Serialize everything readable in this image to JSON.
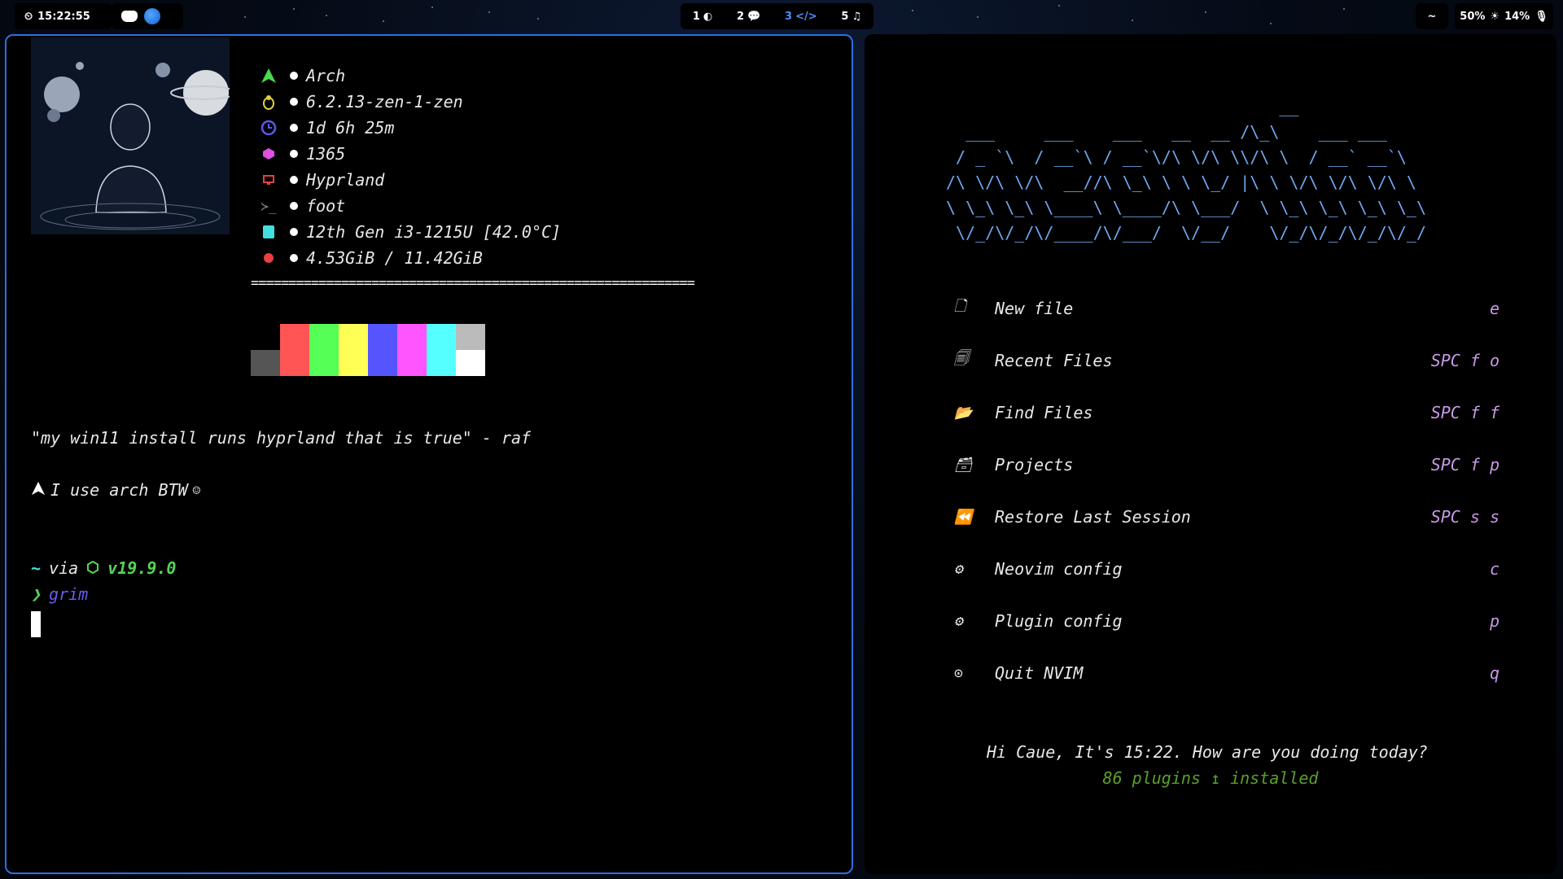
{
  "topbar": {
    "clock": "15:22:55",
    "apps": [
      "discord-icon",
      "browser-icon"
    ],
    "workspaces": [
      {
        "num": "1",
        "icon": "moon-icon",
        "active": false
      },
      {
        "num": "2",
        "icon": "chat-icon",
        "active": false
      },
      {
        "num": "3",
        "icon": "code-icon",
        "glyph": "</>",
        "active": true
      },
      {
        "num": "5",
        "icon": "music-icon",
        "active": false
      }
    ],
    "home": "~",
    "volume": "50%",
    "brightness": "14%"
  },
  "terminal": {
    "fetch": [
      {
        "icon": "arch-icon",
        "color": "#4ad94a",
        "text": "Arch"
      },
      {
        "icon": "linux-icon",
        "color": "#e0d040",
        "text": "6.2.13-zen-1-zen"
      },
      {
        "icon": "clock-icon",
        "color": "#5a5ae8",
        "text": "1d 6h 25m"
      },
      {
        "icon": "package-icon",
        "color": "#e050e0",
        "text": "1365"
      },
      {
        "icon": "monitor-icon",
        "color": "#e84040",
        "text": "Hyprland"
      },
      {
        "icon": "terminal-icon",
        "color": "#888888",
        "text": "foot"
      },
      {
        "icon": "cpu-icon",
        "color": "#40e0e0",
        "text": "12th Gen i3-1215U [42.0°C]"
      },
      {
        "icon": "memory-icon",
        "color": "#e84040",
        "text": "4.53GiB / 11.42GiB"
      }
    ],
    "separator": "===========================================================",
    "palette_top": [
      "#000000",
      "#ff5555",
      "#55ff55",
      "#ffff55",
      "#5555ff",
      "#ff55ff",
      "#55ffff",
      "#bbbbbb"
    ],
    "palette_bottom": [
      "#555555",
      "#ff5555",
      "#55ff55",
      "#ffff55",
      "#5555ff",
      "#ff55ff",
      "#55ffff",
      "#ffffff"
    ],
    "quote": "\"my win11 install runs hyprland that is true\" - raf",
    "btw": "I use arch BTW",
    "prompt_dir": "~",
    "prompt_via": "via",
    "node_version": "v19.9.0",
    "prompt_symbol": "❯",
    "command": "grim"
  },
  "nvim": {
    "logo": "                                  __\n  ___     ___    ___   __  __ /\\_\\    ___ ___\n / _ `\\  / __`\\ / __`\\/\\ \\/\\ \\\\/\\ \\  / __` __`\\\n/\\ \\/\\ \\/\\  __//\\ \\_\\ \\ \\ \\_/ |\\ \\ \\/\\ \\/\\ \\/\\ \\\n\\ \\_\\ \\_\\ \\____\\ \\____/\\ \\___/  \\ \\_\\ \\_\\ \\_\\ \\_\\\n \\/_/\\/_/\\/____/\\/___/  \\/__/    \\/_/\\/_/\\/_/\\/_/",
    "menu": [
      {
        "icon": "file-icon",
        "glyph": "🗋",
        "label": "New file",
        "key": "e"
      },
      {
        "icon": "files-icon",
        "glyph": "🗐",
        "label": "Recent Files",
        "key": "SPC f o"
      },
      {
        "icon": "folder-open-icon",
        "glyph": "📂",
        "label": "Find Files",
        "key": "SPC f f"
      },
      {
        "icon": "archive-icon",
        "glyph": "🗃",
        "label": "Projects",
        "key": "SPC f p"
      },
      {
        "icon": "rewind-icon",
        "glyph": "⏪",
        "label": "Restore Last Session",
        "key": "SPC s s"
      },
      {
        "icon": "gear-icon",
        "glyph": "⚙",
        "label": "Neovim config",
        "key": "c"
      },
      {
        "icon": "gear-icon",
        "glyph": "⚙",
        "label": "Plugin config",
        "key": "p"
      },
      {
        "icon": "power-icon",
        "glyph": "⊙",
        "label": "Quit NVIM",
        "key": "q"
      }
    ],
    "greeting": "Hi Caue, It's 15:22. How are you doing today?",
    "plugins": "86 plugins ↥ installed"
  }
}
